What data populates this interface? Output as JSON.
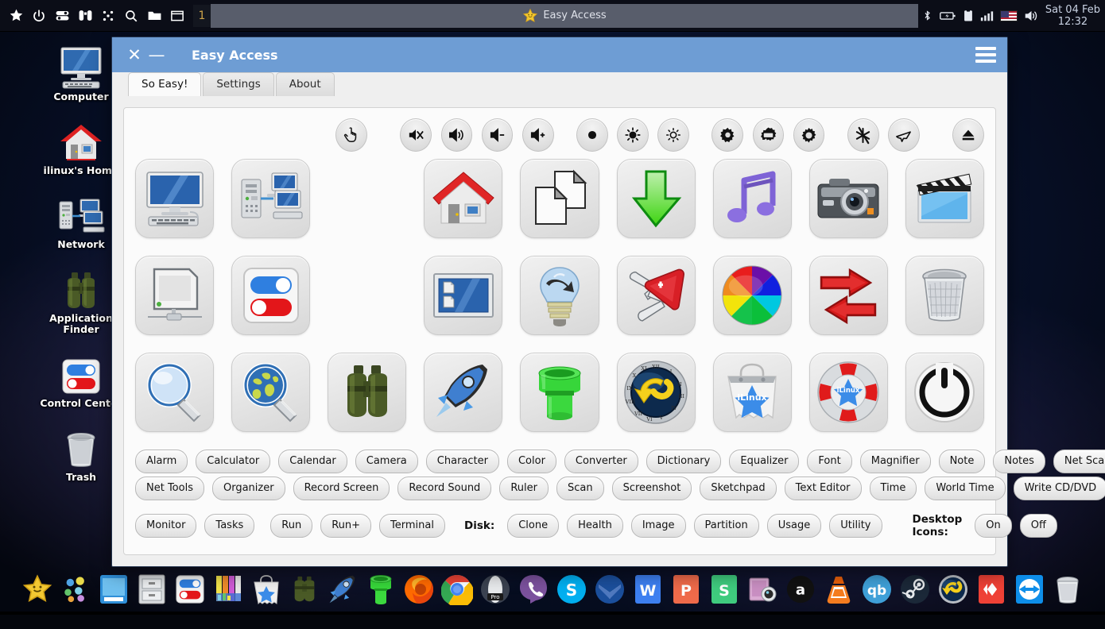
{
  "top_panel": {
    "launcher_icons": [
      "star-icon",
      "power-icon",
      "toggle-icon",
      "binoculars-icon",
      "grid-dots-icon",
      "search-icon",
      "folder-icon",
      "window-icon"
    ],
    "desktop_number": "1",
    "task_button": {
      "label": "Easy Access",
      "icon": "star-icon"
    },
    "tray_icons": [
      "bluetooth-icon",
      "battery-icon",
      "clipboard-icon",
      "signal-icon",
      "flag-icon",
      "volume-icon"
    ],
    "clock_date": "Sat 04 Feb",
    "clock_time": "12:32"
  },
  "desktop_icons": [
    {
      "label": "Computer",
      "icon": "computer-icon"
    },
    {
      "label": "ilinux's Home",
      "icon": "home-icon"
    },
    {
      "label": "Network",
      "icon": "network-icon"
    },
    {
      "label": "Application Finder",
      "icon": "binoculars-icon"
    },
    {
      "label": "Control Center",
      "icon": "toggles-icon"
    },
    {
      "label": "Trash",
      "icon": "trash-icon"
    }
  ],
  "window": {
    "title": "Easy Access",
    "close_label": "✕",
    "minimize_label": "—",
    "menu_icon": "hamburger-icon",
    "tabs": [
      {
        "label": "So Easy!",
        "active": true
      },
      {
        "label": "Settings",
        "active": false
      },
      {
        "label": "About",
        "active": false
      }
    ]
  },
  "toolbar": [
    {
      "name": "cursor-click-icon",
      "glyph": "hand"
    },
    {
      "gap": "l"
    },
    {
      "name": "volume-mute-icon",
      "glyph": "mute"
    },
    {
      "name": "volume-icon",
      "glyph": "vol"
    },
    {
      "name": "volume-down-icon",
      "glyph": "voldown"
    },
    {
      "name": "volume-up-icon",
      "glyph": "volup"
    },
    {
      "gap": "m"
    },
    {
      "name": "screen-off-icon",
      "glyph": "dot"
    },
    {
      "name": "brightness-up-icon",
      "glyph": "sun-rays"
    },
    {
      "name": "brightness-down-icon",
      "glyph": "sun-dim"
    },
    {
      "gap": "m"
    },
    {
      "name": "settings-gear-icon",
      "glyph": "gear"
    },
    {
      "name": "display-settings-icon",
      "glyph": "gear-screen"
    },
    {
      "name": "preferences-icon",
      "glyph": "gear-plain"
    },
    {
      "gap": "m"
    },
    {
      "name": "night-mode-icon",
      "glyph": "snow-star"
    },
    {
      "name": "airplane-mode-icon",
      "glyph": "plane"
    },
    {
      "gap": "l"
    },
    {
      "name": "eject-icon",
      "glyph": "eject"
    }
  ],
  "grid": {
    "rows": [
      [
        {
          "name": "computer-tile",
          "icon": "monitor-icon"
        },
        {
          "name": "network-tile",
          "icon": "network-icon"
        },
        {
          "name": "spacer",
          "icon": "blank"
        },
        {
          "name": "home-tile",
          "icon": "home-icon"
        },
        {
          "name": "documents-tile",
          "icon": "documents-icon"
        },
        {
          "name": "downloads-tile",
          "icon": "download-arrow-icon"
        },
        {
          "name": "music-tile",
          "icon": "music-note-icon"
        },
        {
          "name": "pictures-tile",
          "icon": "camera-icon"
        },
        {
          "name": "videos-tile",
          "icon": "clapperboard-icon"
        }
      ],
      [
        {
          "name": "display-tile",
          "icon": "screen-blank-icon"
        },
        {
          "name": "control-center-tile",
          "icon": "toggles-icon"
        },
        {
          "name": "spacer",
          "icon": "blank"
        },
        {
          "name": "desktop-tile",
          "icon": "desktop-files-icon"
        },
        {
          "name": "ideas-tile",
          "icon": "lightbulb-icon"
        },
        {
          "name": "tools-tile",
          "icon": "swiss-knife-icon"
        },
        {
          "name": "colors-tile",
          "icon": "color-wheel-icon"
        },
        {
          "name": "transfer-tile",
          "icon": "swap-arrows-icon"
        },
        {
          "name": "trash-tile",
          "icon": "trash-icon"
        }
      ],
      [
        {
          "name": "search-tile",
          "icon": "magnifier-icon"
        },
        {
          "name": "web-search-tile",
          "icon": "globe-magnifier-icon"
        },
        {
          "name": "app-finder-tile",
          "icon": "binoculars-icon"
        },
        {
          "name": "launcher-tile",
          "icon": "rocket-icon"
        },
        {
          "name": "install-tile",
          "icon": "green-pipe-icon"
        },
        {
          "name": "history-tile",
          "icon": "clock-back-icon"
        },
        {
          "name": "store-tile",
          "icon": "shopping-bag-icon"
        },
        {
          "name": "help-tile",
          "icon": "lifebuoy-icon"
        },
        {
          "name": "power-tile",
          "icon": "power-icon"
        }
      ]
    ]
  },
  "pill_rows": [
    [
      "Alarm",
      "Calculator",
      "Calendar",
      "Camera",
      "Character",
      "Color",
      "Converter",
      "Dictionary",
      "Equalizer",
      "Font",
      "Magnifier",
      "Note",
      "Notes",
      "Net Scan"
    ],
    [
      "Net Tools",
      "Organizer",
      "Record Screen",
      "Record Sound",
      "Ruler",
      "Scan",
      "Screenshot",
      "Sketchpad",
      "Text Editor",
      "Time",
      "World Time",
      "Write CD/DVD"
    ]
  ],
  "bottom_row": {
    "system": [
      "Monitor",
      "Tasks"
    ],
    "run": [
      "Run",
      "Run+",
      "Terminal"
    ],
    "disk_label": "Disk:",
    "disk": [
      "Clone",
      "Health",
      "Image",
      "Partition",
      "Usage",
      "Utility"
    ],
    "desktop_icons_label": "Desktop Icons:",
    "desktop_icons_options": [
      "On",
      "Off"
    ]
  },
  "dock": [
    "star-icon",
    "bubbles-icon",
    "notes-app-icon",
    "file-cabinet-icon",
    "control-center-icon",
    "color-palette-icon",
    "store-bag-icon",
    "binoculars-icon",
    "rocket-icon",
    "green-pipe-icon",
    "firefox-icon",
    "chrome-icon",
    "opera-pro-icon",
    "viber-icon",
    "skype-icon",
    "thunderbird-icon",
    "wps-writer-icon",
    "wps-presentation-icon",
    "wps-spreadsheet-icon",
    "webcam-icon",
    "amazon-icon",
    "vlc-icon",
    "qbittorrent-icon",
    "steam-icon",
    "undo-icon",
    "anydesk-icon",
    "teamviewer-icon",
    "trash-icon"
  ]
}
